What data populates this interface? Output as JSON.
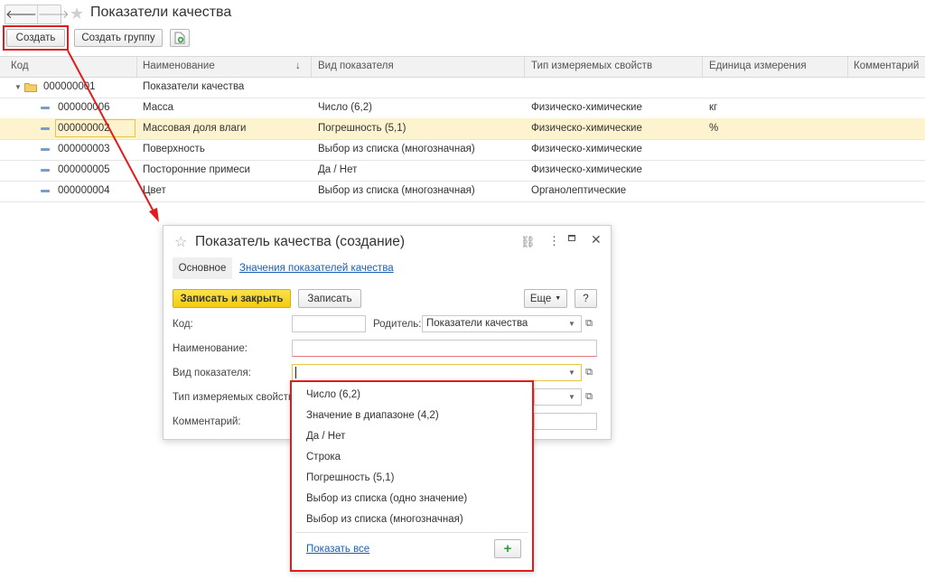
{
  "window": {
    "title": "Показатели качества"
  },
  "toolbar": {
    "create_label": "Создать",
    "create_group_label": "Создать группу"
  },
  "table": {
    "columns": [
      "Код",
      "Наименование",
      "Вид показателя",
      "Тип измеряемых свойств",
      "Единица измерения",
      "Комментарий"
    ],
    "sort_indicator": "↓",
    "group_row": {
      "code": "000000001",
      "name": "Показатели качества"
    },
    "rows": [
      {
        "code": "000000006",
        "name": "Масса",
        "kind": "Число (6,2)",
        "type": "Физическо-химические",
        "unit": "кг",
        "selected": false
      },
      {
        "code": "000000002",
        "name": "Массовая доля влаги",
        "kind": "Погрешность (5,1)",
        "type": "Физическо-химические",
        "unit": "%",
        "selected": true
      },
      {
        "code": "000000003",
        "name": "Поверхность",
        "kind": "Выбор из списка (многозначная)",
        "type": "Физическо-химические",
        "unit": "",
        "selected": false
      },
      {
        "code": "000000005",
        "name": "Посторонние примеси",
        "kind": "Да / Нет",
        "type": "Физическо-химические",
        "unit": "",
        "selected": false
      },
      {
        "code": "000000004",
        "name": "Цвет",
        "kind": "Выбор из списка (многозначная)",
        "type": "Органолептические",
        "unit": "",
        "selected": false
      }
    ]
  },
  "dialog": {
    "title": "Показатель качества (создание)",
    "tab_main": "Основное",
    "tab_values_link": "Значения показателей качества",
    "save_close_label": "Записать и закрыть",
    "save_label": "Записать",
    "more_label": "Еще",
    "help_label": "?",
    "code_label": "Код:",
    "code_value": "",
    "parent_label": "Родитель:",
    "parent_value": "Показатели качества",
    "name_label": "Наименование:",
    "name_value": "",
    "kind_label": "Вид показателя:",
    "kind_value": "",
    "type_label": "Тип измеряемых свойств:",
    "comment_label": "Комментарий:",
    "comment_value": ""
  },
  "dropdown": {
    "options": [
      "Число (6,2)",
      "Значение в диапазоне (4,2)",
      "Да / Нет",
      "Строка",
      "Погрешность (5,1)",
      "Выбор из списка (одно значение)",
      "Выбор из списка (многозначная)"
    ],
    "show_all_label": "Показать все",
    "add_label": "+"
  },
  "colors": {
    "highlight_red": "#e01c1c",
    "primary_yellow": "#f5d21d",
    "selected_row": "#fdf3cf",
    "link_blue": "#1a5fb4",
    "add_green": "#2e9e3e"
  }
}
